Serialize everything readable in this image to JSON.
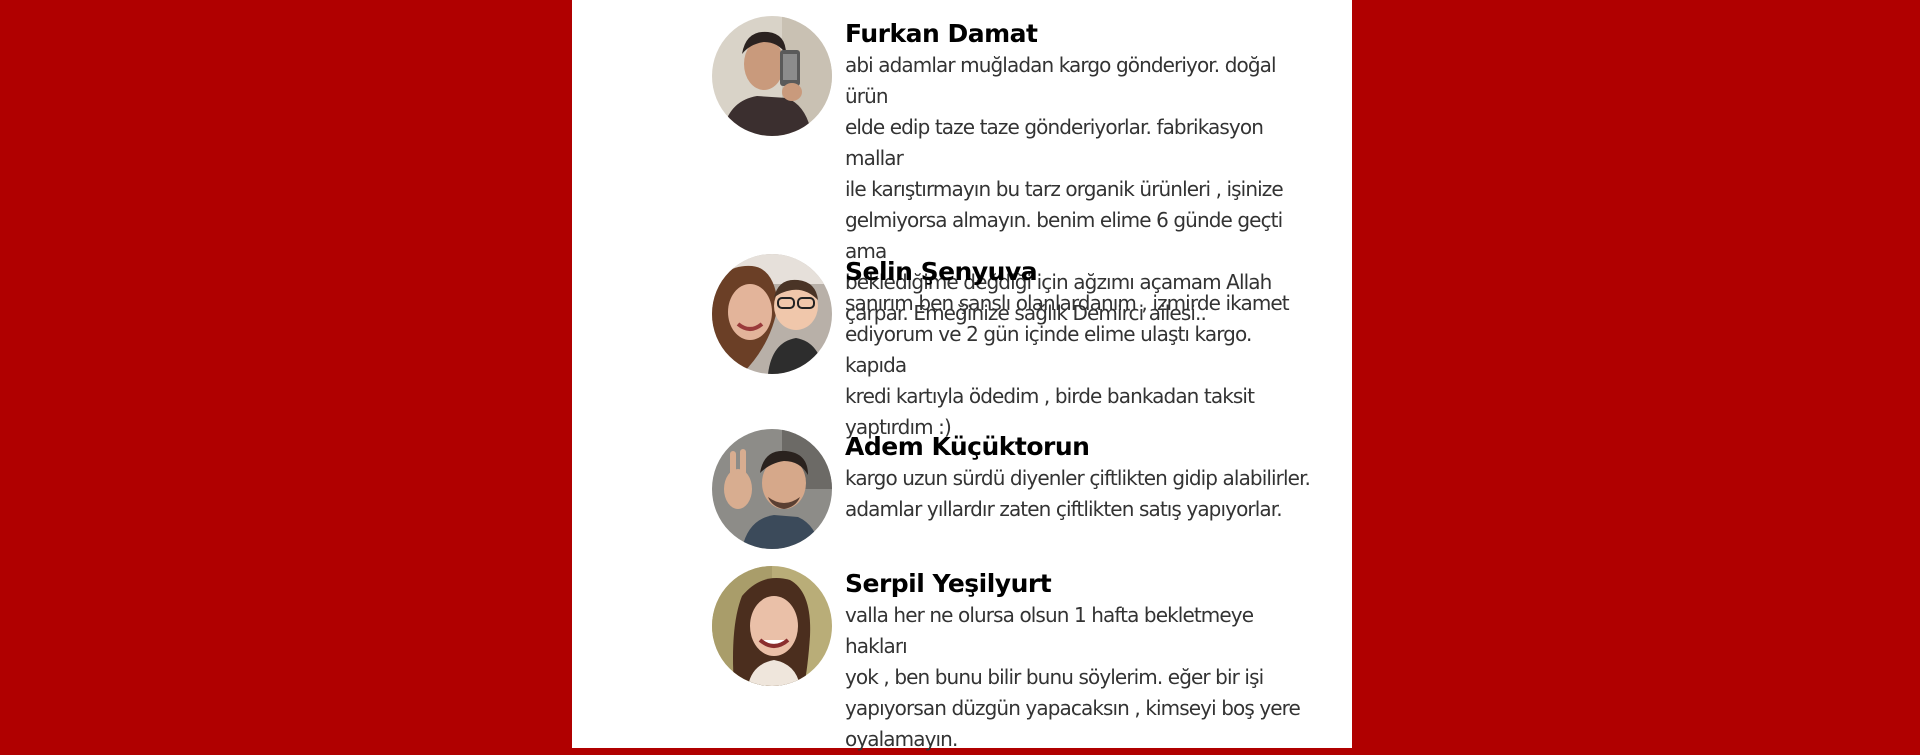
{
  "reviews": [
    {
      "name": "Furkan Damat",
      "text": "abi adamlar muğladan kargo gönderiyor. doğal ürün\nelde edip taze taze gönderiyorlar. fabrikasyon mallar\nile karıştırmayın bu tarz organik ürünleri , işinize\ngelmiyorsa almayın. benim elime 6 günde geçti ama\nbeklediğime değdiği için ağzımı açamam Allah\nçarpar. Emeğinize sağlık Demirci ailesi..",
      "avatar": "man-selfie-with-phone-avatar"
    },
    {
      "name": "Selin Şenyuva",
      "text": "sanırım ben şanslı olanlardanım , izmirde ikamet\nediyorum ve 2 gün içinde elime ulaştı kargo. kapıda\nkredi kartıyla ödedim , birde bankadan taksit\nyaptırdım :)",
      "avatar": "woman-and-child-avatar"
    },
    {
      "name": "Adem Küçüktorun",
      "text": "kargo uzun sürdü diyenler çiftlikten gidip alabilirler.\nadamlar yıllardır zaten çiftlikten satış yapıyorlar.",
      "avatar": "man-waving-avatar"
    },
    {
      "name": "Serpil Yeşilyurt",
      "text": "valla her ne olursa olsun 1 hafta bekletmeye hakları\nyok , ben bunu bilir bunu söylerim. eğer bir işi\nyapıyorsan düzgün yapacaksın , kimseyi boş yere\noyalamayın.",
      "avatar": "smiling-woman-avatar"
    }
  ],
  "colors": {
    "background": "#b00000",
    "panel": "#ffffff",
    "name": "#000000",
    "text": "#333333"
  }
}
